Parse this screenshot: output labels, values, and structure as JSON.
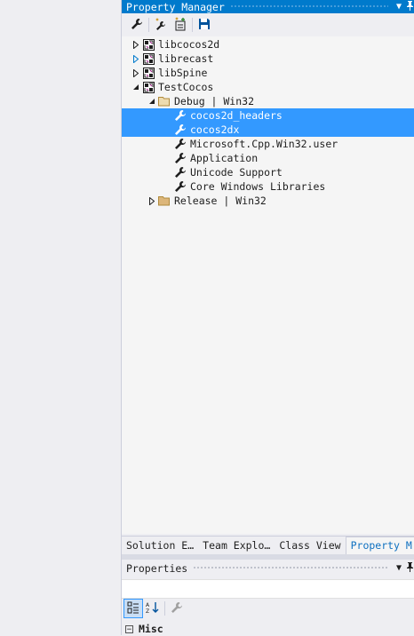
{
  "panel": {
    "title": "Property Manager",
    "toolbar": [
      {
        "icon": "wrench-icon"
      },
      {
        "icon": "add-new-property-sheet-icon"
      },
      {
        "icon": "add-existing-property-sheet-icon"
      },
      {
        "icon": "save-icon"
      }
    ]
  },
  "tree": [
    {
      "label": "libcocos2d",
      "level": 0,
      "expander": "collapsed",
      "icon": "project-icon",
      "selected": false
    },
    {
      "label": "librecast",
      "level": 0,
      "expander": "collapsed-blue",
      "icon": "project-icon",
      "selected": false
    },
    {
      "label": "libSpine",
      "level": 0,
      "expander": "collapsed",
      "icon": "project-icon",
      "selected": false
    },
    {
      "label": "TestCocos",
      "level": 0,
      "expander": "expanded",
      "icon": "project-icon",
      "selected": false
    },
    {
      "label": "Debug | Win32",
      "level": 1,
      "expander": "expanded",
      "icon": "folder-open-icon",
      "selected": false
    },
    {
      "label": "cocos2d_headers",
      "level": 2,
      "expander": "none",
      "icon": "wrench-icon",
      "selected": true
    },
    {
      "label": "cocos2dx",
      "level": 2,
      "expander": "none",
      "icon": "wrench-icon",
      "selected": true
    },
    {
      "label": "Microsoft.Cpp.Win32.user",
      "level": 2,
      "expander": "none",
      "icon": "wrench-icon",
      "selected": false
    },
    {
      "label": "Application",
      "level": 2,
      "expander": "none",
      "icon": "wrench-icon",
      "selected": false
    },
    {
      "label": "Unicode Support",
      "level": 2,
      "expander": "none",
      "icon": "wrench-icon",
      "selected": false
    },
    {
      "label": "Core Windows Libraries",
      "level": 2,
      "expander": "none",
      "icon": "wrench-icon",
      "selected": false
    },
    {
      "label": "Release | Win32",
      "level": 1,
      "expander": "collapsed",
      "icon": "folder-icon",
      "selected": false
    }
  ],
  "tabs": [
    {
      "label": "Solution E…",
      "active": false
    },
    {
      "label": "Team Explo…",
      "active": false
    },
    {
      "label": "Class View",
      "active": false
    },
    {
      "label": "Property M",
      "active": true
    }
  ],
  "properties": {
    "title": "Properties",
    "category": "Misc"
  },
  "colors": {
    "accent": "#007acc",
    "selection": "#3399ff"
  }
}
